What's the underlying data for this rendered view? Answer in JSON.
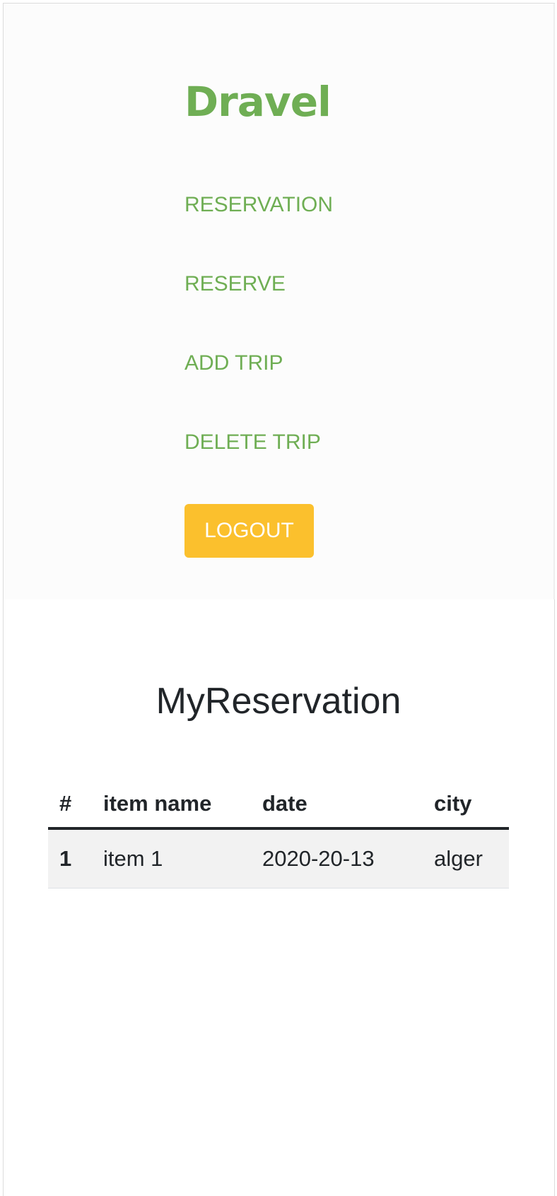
{
  "brand": {
    "name": "Dravel"
  },
  "nav": {
    "items": [
      {
        "label": "RESERVATION"
      },
      {
        "label": "RESERVE"
      },
      {
        "label": "ADD TRIP"
      },
      {
        "label": "DELETE TRIP"
      }
    ],
    "logout_label": "LOGOUT"
  },
  "page": {
    "title": "MyReservation"
  },
  "table": {
    "headers": [
      "#",
      "item name",
      "date",
      "city"
    ],
    "rows": [
      [
        "1",
        "item 1",
        "2020-20-13",
        "alger"
      ]
    ]
  },
  "colors": {
    "brand_green": "#6fae54",
    "logout_yellow": "#fbc02d",
    "text_dark": "#212529",
    "row_stripe": "#f2f2f2"
  }
}
